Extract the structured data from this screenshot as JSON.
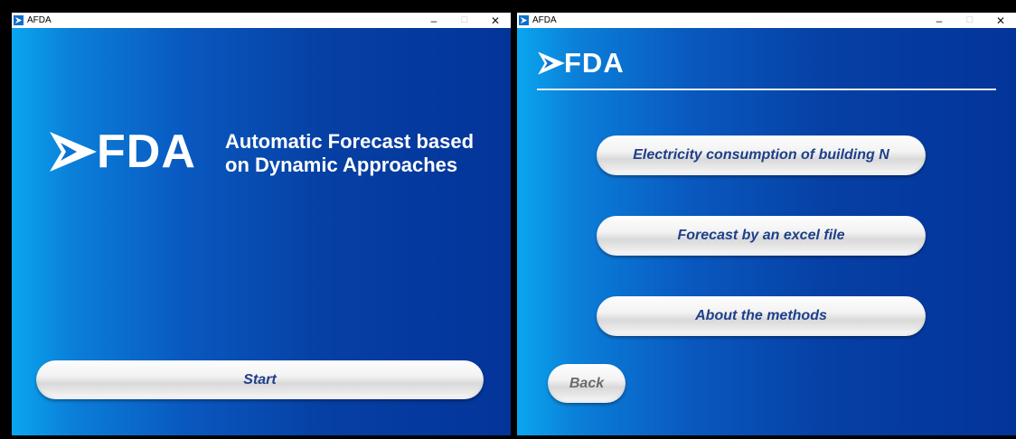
{
  "left_window": {
    "title": "AFDA",
    "controls": {
      "minimize": "–",
      "maximize": "□",
      "close": "✕"
    },
    "logo_text": "FDA",
    "tagline_line1": "Automatic Forecast based",
    "tagline_line2": "on Dynamic Approaches",
    "start_button": "Start"
  },
  "right_window": {
    "title": "AFDA",
    "controls": {
      "minimize": "–",
      "maximize": "□",
      "close": "✕"
    },
    "logo_text": "FDA",
    "menu": [
      "Electricity consumption of building N",
      "Forecast by an excel file",
      "About the methods"
    ],
    "back_button": "Back"
  },
  "colors": {
    "gradient_light": "#0aa6ee",
    "gradient_dark": "#03349a",
    "button_text": "#1e3f8a",
    "back_text": "#6b6b6b"
  }
}
